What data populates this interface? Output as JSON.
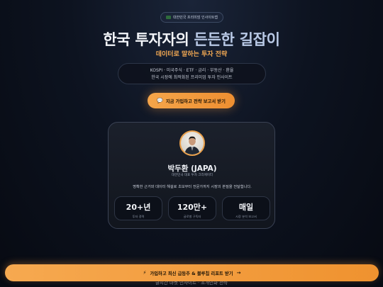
{
  "badge": {
    "text": "대한민국 프리미엄 인사이트랩",
    "icon": "korea-flag-icon"
  },
  "hero": {
    "title_a": "한국 투자자의 ",
    "title_b": "든든한 길잡이",
    "subtitle": "데이터로 말하는 투자 전략"
  },
  "topics": {
    "line1": "KOSPI · 미국주식 · ETF · 금리 · 부동산 · 환율",
    "line2": "한국 시장에 최적화된 프리미엄 투자 인사이트"
  },
  "cta_top": {
    "icon": "chat-icon",
    "glyph": "💬",
    "label": "지금 가입하고 전략 보고서 받기"
  },
  "profile": {
    "name": "박두환 (JAPA)",
    "role": "대한민국 대표 투자 크리에이터",
    "description": "명확한 근거와 데이터 해설로 초보부터 전문가까지 시장의 본질을 전달합니다.",
    "stats": [
      {
        "value": "20+년",
        "label": "투자 경력"
      },
      {
        "value": "120만+",
        "label": "글로벌 구독자"
      },
      {
        "value": "매일",
        "label": "시장 분석 보고서"
      }
    ]
  },
  "bottom_text": "글시간 마켓 인사이트 · 초개인화 전략",
  "cta_bottom": {
    "icon": "lightning-icon",
    "glyph": "⚡",
    "label": "가입하고 최신 급등주 & 블루칩 리포트 받기",
    "arrow": "→"
  },
  "colors": {
    "accent": "#f0962f",
    "background": "#0d1320"
  }
}
